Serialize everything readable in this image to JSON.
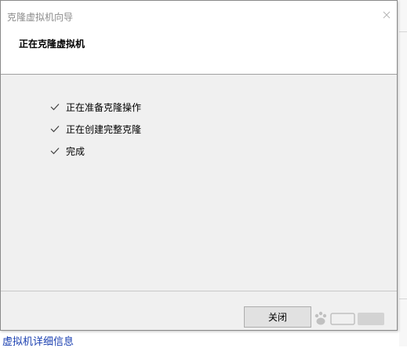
{
  "dialog": {
    "title": "克隆虚拟机向导",
    "heading": "正在克隆虚拟机",
    "steps": [
      {
        "label": "正在准备克隆操作",
        "status": "done"
      },
      {
        "label": "正在创建完整克隆",
        "status": "done"
      },
      {
        "label": "完成",
        "status": "done"
      }
    ],
    "close_button_label": "关闭"
  },
  "background": {
    "link_text": "虚拟机详细信息"
  },
  "icons": {
    "close": "close-icon",
    "check": "check-icon",
    "watermark": "baidu-jingyan-watermark"
  },
  "colors": {
    "dialog_bg": "#f0f0f0",
    "header_bg": "#ffffff",
    "title_text": "#8c8c8c",
    "link": "#1a3fb0",
    "button_bg": "#e1e1e1",
    "button_border": "#adadad"
  }
}
